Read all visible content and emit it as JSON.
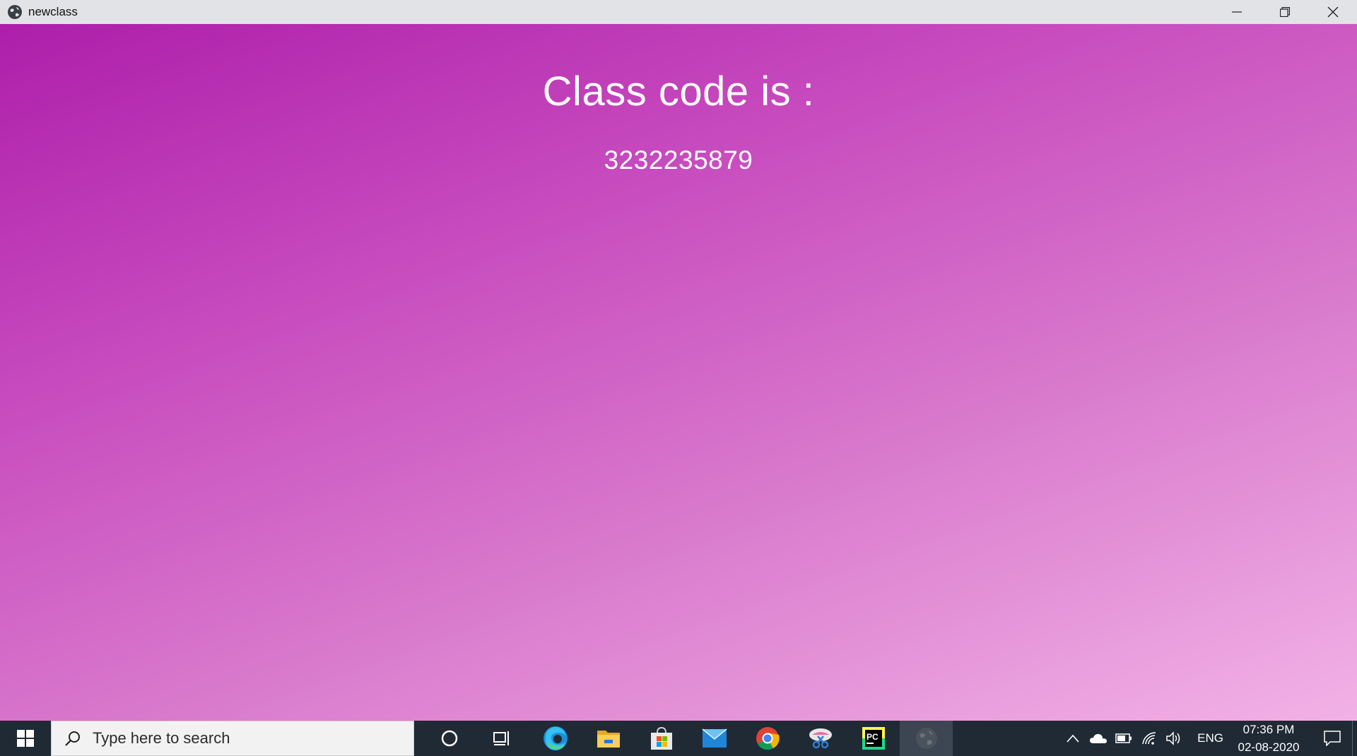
{
  "window": {
    "title": "newclass",
    "app_icon": "globe-icon",
    "controls": [
      "minimize-icon",
      "restore-icon",
      "close-icon"
    ]
  },
  "content": {
    "heading": "Class code is :",
    "class_code": "3232235879",
    "gradient_colors": [
      "#ad1faa",
      "#c648bd",
      "#d878cc",
      "#f2b2e6"
    ]
  },
  "taskbar": {
    "search_placeholder": "Type here to search",
    "pinned_apps": [
      {
        "name": "cortana",
        "icon": "cortana-icon"
      },
      {
        "name": "task-view",
        "icon": "task-view-icon"
      },
      {
        "name": "edge",
        "icon": "edge-icon"
      },
      {
        "name": "file-explorer",
        "icon": "folder-icon"
      },
      {
        "name": "microsoft-store",
        "icon": "store-icon"
      },
      {
        "name": "mail",
        "icon": "mail-icon"
      },
      {
        "name": "chrome",
        "icon": "chrome-icon"
      },
      {
        "name": "snip-sketch",
        "icon": "snip-icon"
      },
      {
        "name": "pycharm",
        "icon": "pycharm-icon",
        "label": "PC"
      },
      {
        "name": "newclass",
        "icon": "globe-icon",
        "active": true
      }
    ],
    "tray": {
      "language": "ENG",
      "time": "07:36 PM",
      "date": "02-08-2020"
    }
  }
}
